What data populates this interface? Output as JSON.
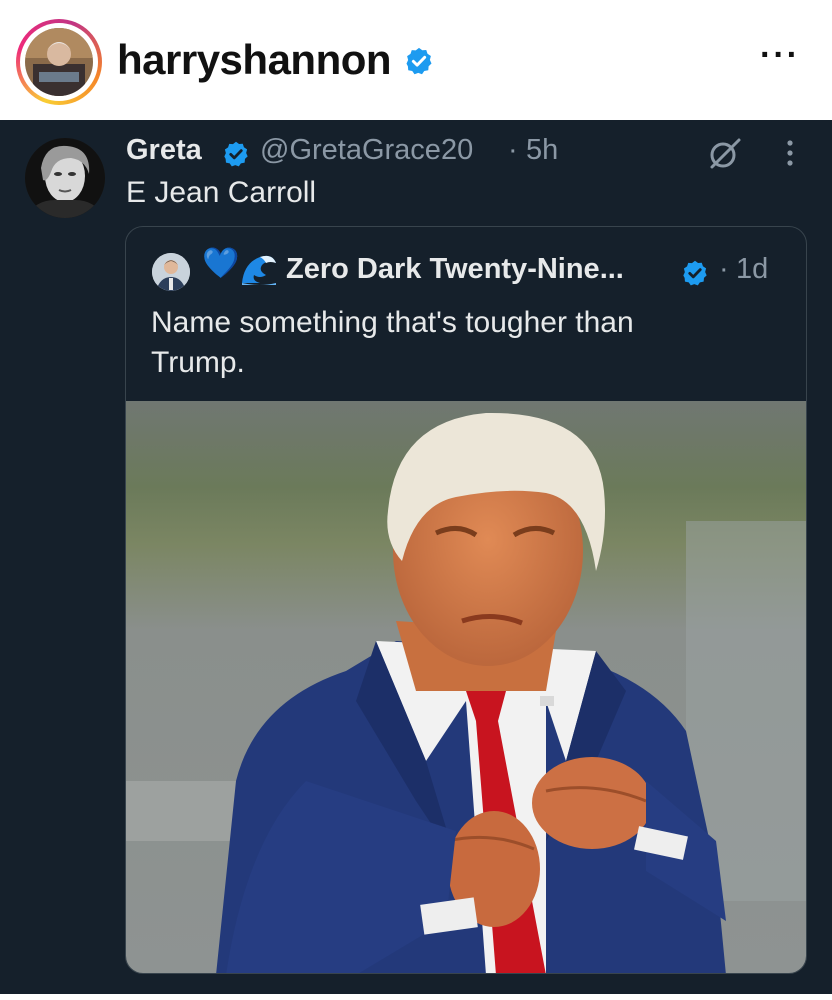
{
  "header": {
    "username": "harryshannon",
    "more_icon": "ellipsis-icon",
    "verified_icon": "verified-badge-icon",
    "avatar_icon": "profile-photo"
  },
  "tweet": {
    "author_name": "Greta",
    "author_handle": "@GretaGrace20",
    "separator": "·",
    "time": "5h",
    "text": "E Jean Carroll",
    "grok_icon": "grok-icon",
    "menu_icon": "vertical-dots-icon",
    "quote": {
      "emoji_heart": "💙",
      "emoji_wave": "🌊",
      "author_name": "Zero Dark Twenty-Nine...",
      "separator": "·",
      "time": "1d",
      "text_line1": "Name something that's tougher than",
      "text_line2": "Trump.",
      "media_icon": "photo"
    }
  },
  "colors": {
    "tweet_bg": "#15202b",
    "text_primary": "#e7e9ea",
    "text_secondary": "#8b98a5",
    "verified_blue": "#1d9bf0",
    "border": "#38444d"
  }
}
